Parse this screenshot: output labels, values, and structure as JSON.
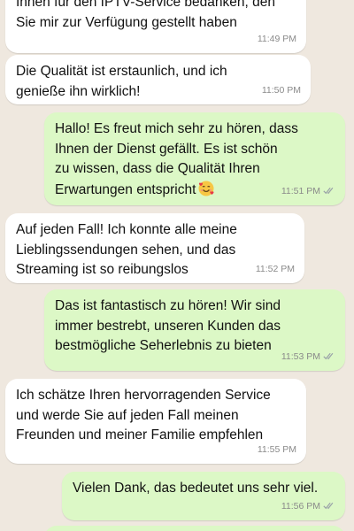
{
  "messages": [
    {
      "direction": "in",
      "text": "Ihnen für den IPTV-Service bedanken, den\nSie mir zur Verfügung gestellt haben",
      "time": "11:49 PM"
    },
    {
      "direction": "in",
      "text": "Die Qualität ist erstaunlich, und ich\ngenieße ihn wirklich!",
      "time": "11:50 PM"
    },
    {
      "direction": "out",
      "text": "Hallo! Es freut mich sehr zu hören, dass\nIhnen der Dienst gefällt. Es ist schön\nzu wissen, dass die Qualität Ihren\nErwartungen entspricht",
      "emoji": "smiling-face-with-hearts-emoji",
      "time": "11:51 PM",
      "status": "read-double-check-icon"
    },
    {
      "direction": "in",
      "text": "Auf jeden Fall! Ich konnte alle meine\nLieblingssendungen sehen, und das\nStreaming ist so reibungslos",
      "time": "11:52 PM"
    },
    {
      "direction": "out",
      "text": "Das ist fantastisch zu hören! Wir sind\nimmer bestrebt, unseren Kunden das\nbestmögliche Seherlebnis zu bieten",
      "time": "11:53 PM",
      "status": "read-double-check-icon"
    },
    {
      "direction": "in",
      "text": "Ich schätze Ihren hervorragenden Service\nund werde Sie auf jeden Fall meinen\nFreunden und meiner Familie empfehlen",
      "time": "11:55 PM"
    },
    {
      "direction": "out",
      "text": "Vielen Dank, das bedeutet uns sehr viel.",
      "time": "11:56 PM",
      "status": "read-double-check-icon"
    }
  ],
  "colors": {
    "background": "#efe8df",
    "incoming_bubble": "#ffffff",
    "outgoing_bubble": "#dcf8c6",
    "meta_text": "#8a8a8a"
  }
}
